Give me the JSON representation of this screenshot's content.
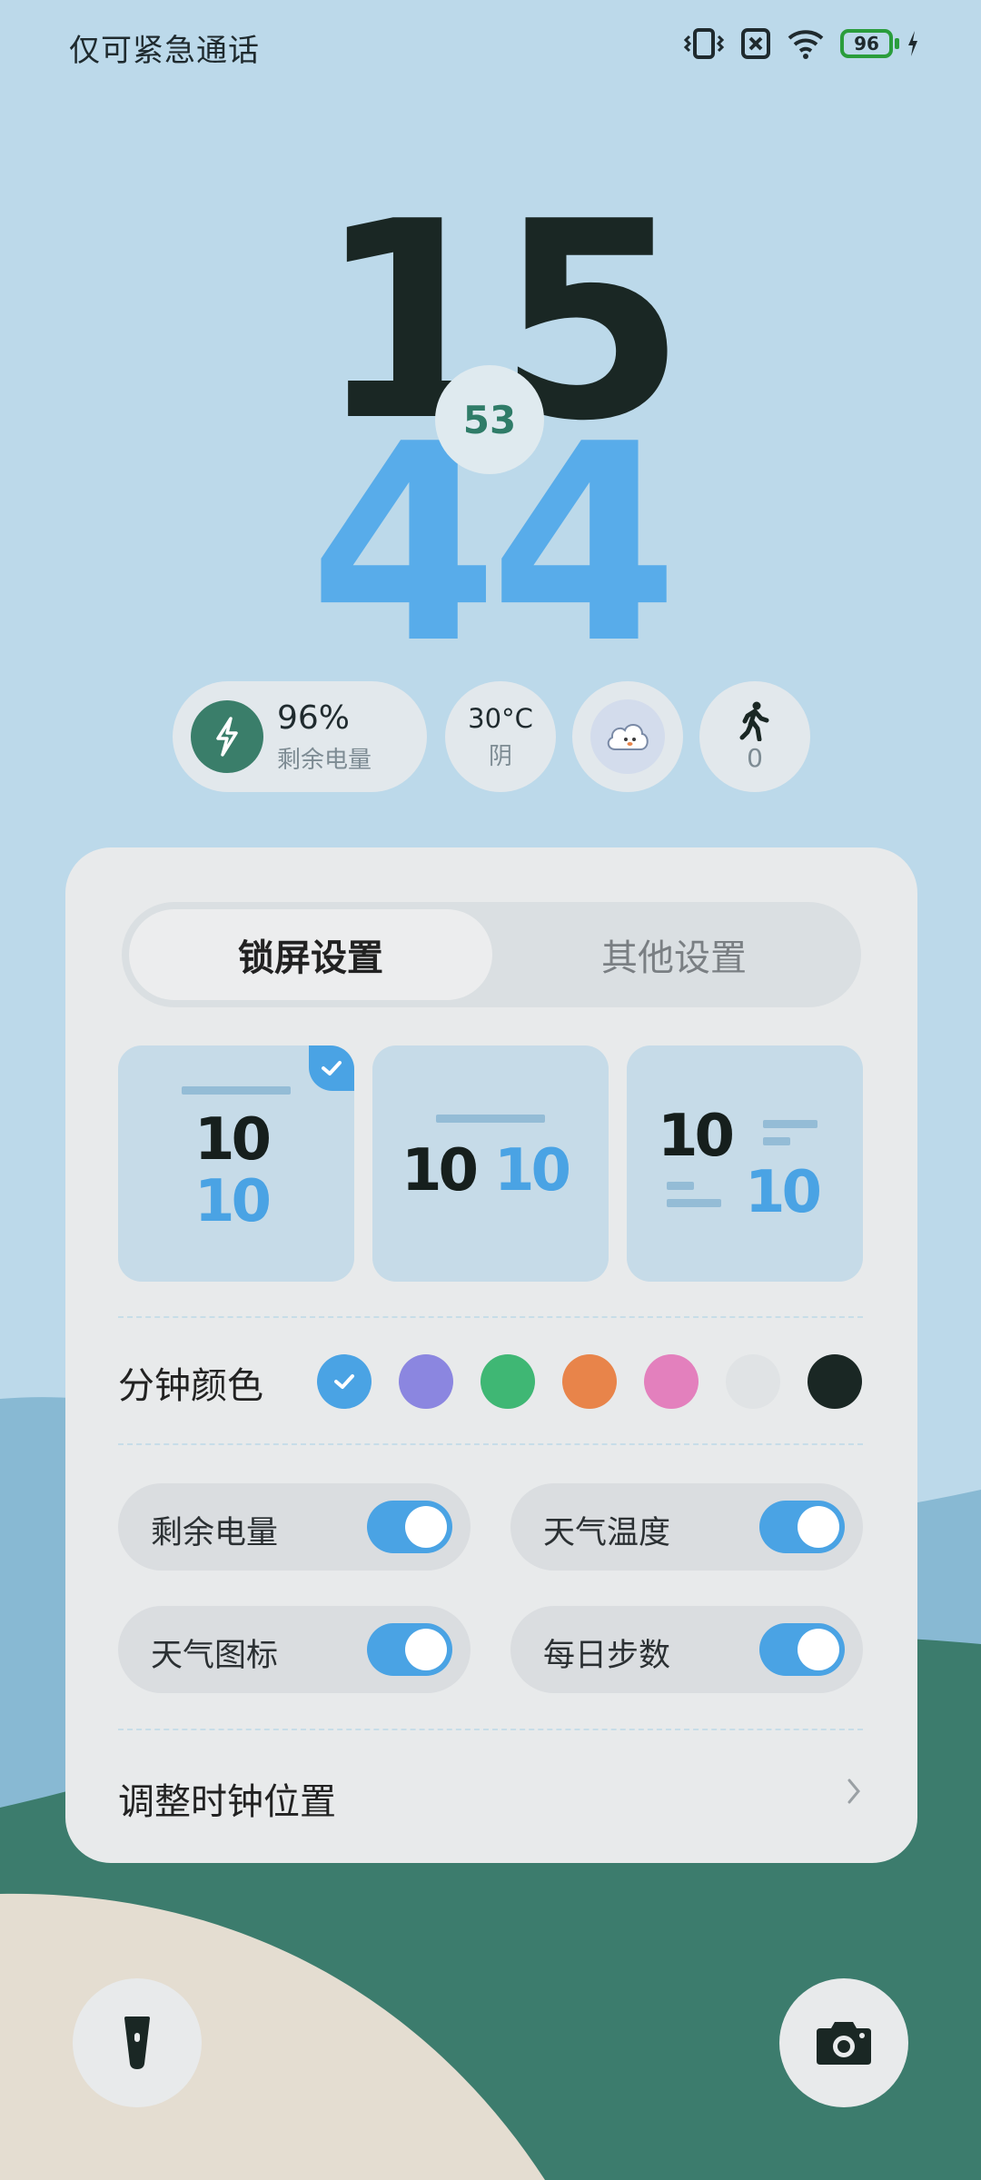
{
  "status_bar": {
    "carrier": "仅可紧急通话",
    "battery_level": "96",
    "icons": [
      "vibrate-icon",
      "no-sim-icon",
      "wifi-icon",
      "battery-icon",
      "charging-bolt-icon"
    ]
  },
  "clock": {
    "hour": "15",
    "minute": "44",
    "second": "53"
  },
  "widgets": {
    "battery_percent": "96%",
    "battery_label": "剩余电量",
    "temperature": "30°C",
    "condition": "阴",
    "weather_icon": "cloud-face-icon",
    "steps": "0",
    "steps_icon": "walking-person-icon"
  },
  "panel": {
    "tabs": [
      {
        "label": "锁屏设置",
        "active": true
      },
      {
        "label": "其他设置",
        "active": false
      }
    ],
    "clock_styles": [
      {
        "sample": "10",
        "selected": true
      },
      {
        "sample": "10",
        "selected": false
      },
      {
        "sample": "10",
        "selected": false
      }
    ],
    "minute_color_label": "分钟颜色",
    "minute_colors": [
      {
        "hex": "#4aa3e4",
        "selected": true
      },
      {
        "hex": "#8b86e0",
        "selected": false
      },
      {
        "hex": "#3fb774",
        "selected": false
      },
      {
        "hex": "#e8844a",
        "selected": false
      },
      {
        "hex": "#e380bd",
        "selected": false
      },
      {
        "hex": "#e0e3e5",
        "selected": false
      },
      {
        "hex": "#1a2724",
        "selected": false
      }
    ],
    "toggles": [
      {
        "label": "剩余电量",
        "on": true
      },
      {
        "label": "天气温度",
        "on": true
      },
      {
        "label": "天气图标",
        "on": true
      },
      {
        "label": "每日步数",
        "on": true
      }
    ],
    "adjust_position_label": "调整时钟位置"
  },
  "bottom": {
    "left_button": "flashlight-icon",
    "right_button": "camera-icon"
  },
  "colors": {
    "accent": "#4aa3e4",
    "hour_color": "#1a2724",
    "minute_color": "#58acea",
    "second_color": "#2f7c68",
    "sky": "#bcd9ea"
  }
}
